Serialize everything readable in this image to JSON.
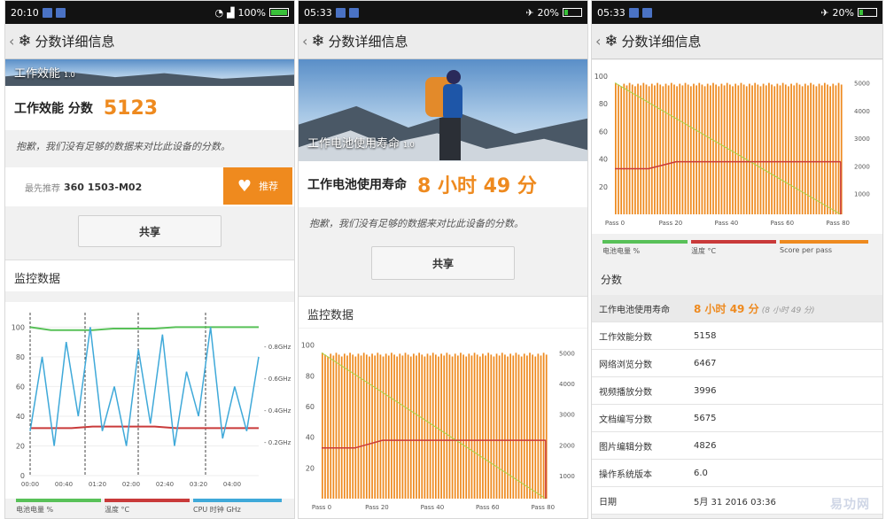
{
  "colors": {
    "accent": "#ee8a1f",
    "battery": "#58c158",
    "temp": "#c93a3a",
    "cpu": "#3fa9d9",
    "bars": "#ee8a1f"
  },
  "screen1": {
    "status": {
      "time": "20:10",
      "right": "100%"
    },
    "appbar": {
      "back": "‹",
      "title": "分数详细信息"
    },
    "hero_label": "工作效能",
    "hero_version": "1.0",
    "score_label": "工作效能 分数",
    "score_value": "5123",
    "note": "抱歉，我们没有足够的数据来对比此设备的分数。",
    "rec_prefix": "最先推荐",
    "rec_device": "360 1503-M02",
    "rec_button": "推荐",
    "share": "共享",
    "monitor": "监控数据",
    "legend": [
      "电池电量 %",
      "温度 °C",
      "CPU 时钟 GHz"
    ]
  },
  "screen2": {
    "status": {
      "time": "05:33",
      "right": "20%"
    },
    "appbar": {
      "back": "‹",
      "title": "分数详细信息"
    },
    "hero_label": "工作电池使用寿命",
    "hero_version": "1.0",
    "score_label": "工作电池使用寿命",
    "score_value": "8 小时 49 分",
    "note": "抱歉，我们没有足够的数据来对比此设备的分数。",
    "share": "共享",
    "monitor": "监控数据"
  },
  "screen3": {
    "status": {
      "time": "05:33",
      "right": "20%"
    },
    "appbar": {
      "back": "‹",
      "title": "分数详细信息"
    },
    "legend": [
      "电池电量 %",
      "温度 °C",
      "Score per pass"
    ],
    "section": "分数",
    "rows": [
      {
        "k": "工作电池使用寿命",
        "v": "8 小时 49 分",
        "extra": "(8 小时 49 分)"
      },
      {
        "k": "工作效能分数",
        "v": "5158"
      },
      {
        "k": "网络浏览分数",
        "v": "6467"
      },
      {
        "k": "视频播放分数",
        "v": "3996"
      },
      {
        "k": "文档编写分数",
        "v": "5675"
      },
      {
        "k": "图片编辑分数",
        "v": "4826"
      },
      {
        "k": "操作系统版本",
        "v": "6.0"
      },
      {
        "k": "日期",
        "v": "5月 31 2016 03:36"
      }
    ],
    "watermark": "易功网"
  },
  "chart_data": [
    {
      "type": "line",
      "x_ticks": [
        "00:00",
        "00:40",
        "01:20",
        "02:00",
        "02:40",
        "03:20",
        "04:00"
      ],
      "y_left_ticks": [
        "100",
        "80",
        "60",
        "40",
        "20",
        "0"
      ],
      "y_right_ticks": [
        "0.8GHz",
        "0.6GHz",
        "0.4GHz",
        "0.2GHz"
      ],
      "ylim": [
        0,
        105
      ],
      "series": [
        {
          "name": "电池电量 %",
          "values": [
            100,
            98,
            98,
            98,
            99,
            99,
            99,
            100,
            100,
            100,
            100,
            100
          ]
        },
        {
          "name": "温度 °C",
          "values": [
            32,
            32,
            32,
            33,
            33,
            33,
            33,
            32,
            32,
            32,
            32,
            32
          ]
        },
        {
          "name": "CPU 时钟 GHz",
          "values": [
            30,
            80,
            20,
            90,
            40,
            100,
            30,
            60,
            20,
            85,
            35,
            95,
            20,
            70,
            40,
            100,
            25,
            60,
            30,
            80
          ]
        }
      ]
    },
    {
      "type": "bar",
      "x_ticks": [
        "Pass 0",
        "Pass 20",
        "Pass 40",
        "Pass 60",
        "Pass 80"
      ],
      "y_left_ticks": [
        "100",
        "80",
        "60",
        "40",
        "20"
      ],
      "y_right_ticks": [
        "5000",
        "4000",
        "3000",
        "2000",
        "1000"
      ],
      "passes": 82,
      "bar_value": 95,
      "battery_line": [
        95,
        0
      ],
      "temp_line": [
        33,
        38
      ]
    },
    {
      "type": "bar",
      "x_ticks": [
        "Pass 0",
        "Pass 20",
        "Pass 40",
        "Pass 60",
        "Pass 80"
      ],
      "y_left_ticks": [
        "100",
        "80",
        "60",
        "40",
        "20"
      ],
      "y_right_ticks": [
        "5000",
        "4000",
        "3000",
        "2000",
        "1000"
      ],
      "passes": 82,
      "bar_value": 95,
      "battery_line": [
        95,
        0
      ],
      "temp_line": [
        33,
        38
      ]
    }
  ]
}
